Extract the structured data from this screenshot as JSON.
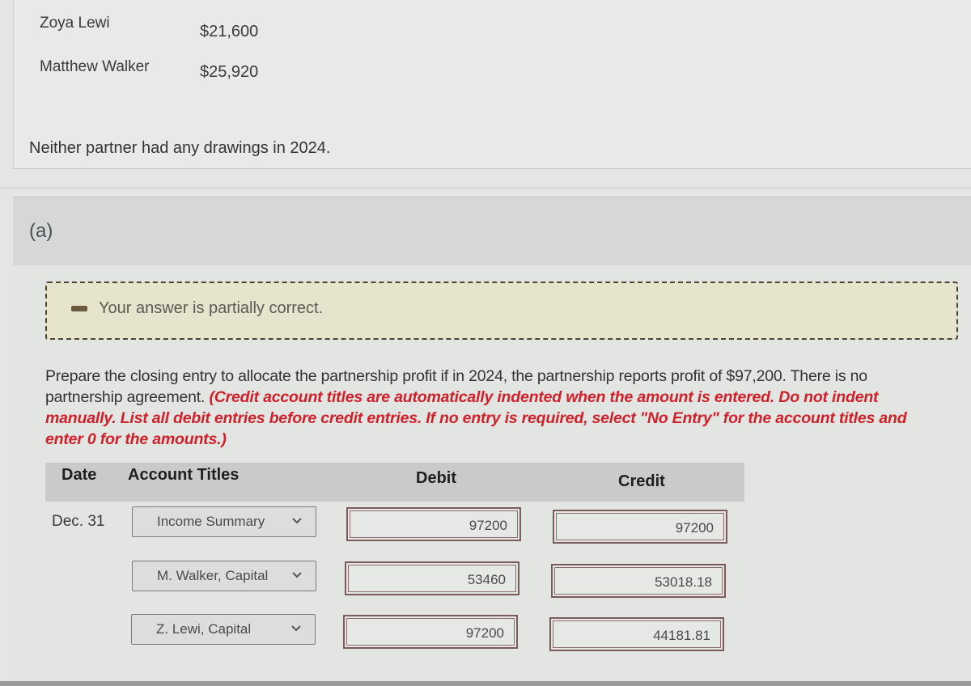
{
  "partners": [
    {
      "name": "Zoya Lewi",
      "amount": "$21,600"
    },
    {
      "name": "Matthew Walker",
      "amount": "$25,920"
    }
  ],
  "drawings_note": "Neither partner had any drawings in 2024.",
  "part": {
    "label": "(a)"
  },
  "feedback": {
    "icon": "partial-correct-icon",
    "text": "Your answer is partially correct.",
    "border_color": "#4a4338",
    "background_color": "#e6e4cc"
  },
  "instructions": {
    "main": "Prepare the closing entry to allocate the partnership profit if in 2024, the partnership reports profit of $97,200. There is no partnership agreement. ",
    "note": "(Credit account titles are automatically indented when the amount is entered. Do not indent manually. List all debit entries before credit entries. If no entry is required, select \"No Entry\" for the account titles and enter 0 for the amounts.)",
    "note_color": "#d0202a"
  },
  "journal": {
    "headers": {
      "date": "Date",
      "account_titles": "Account Titles",
      "debit": "Debit",
      "credit": "Credit"
    },
    "rows": [
      {
        "date": "Dec. 31",
        "account": "Income Summary",
        "debit": "97200",
        "credit": "97200"
      },
      {
        "date": "",
        "account": "M. Walker, Capital",
        "debit": "53460",
        "credit": "53018.18"
      },
      {
        "date": "",
        "account": "Z. Lewi, Capital",
        "debit": "97200",
        "credit": "44181.81"
      }
    ]
  }
}
